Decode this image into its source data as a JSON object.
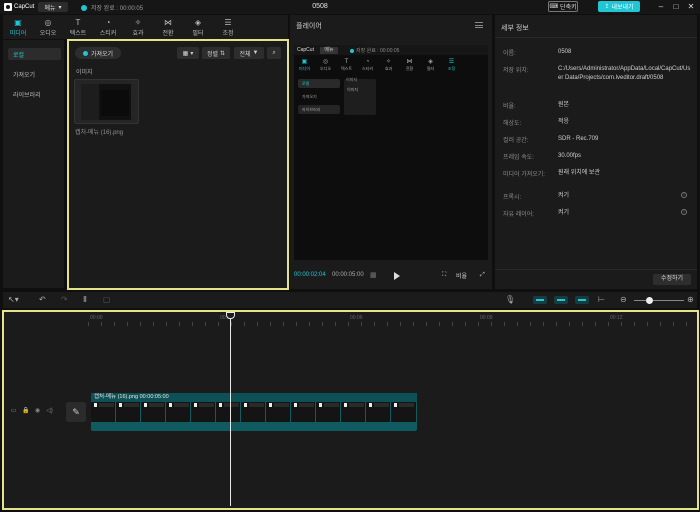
{
  "app": {
    "name": "CapCut",
    "menu_label": "메뉴",
    "autosave_text": "저장 완료 : 00:00:05",
    "project_title": "0508",
    "shortcut_label": "단축키",
    "export_label": "내보내기",
    "colors": {
      "accent": "#1fc7d4",
      "highlight_border": "#e6e28a"
    }
  },
  "toolbar": {
    "tools": [
      {
        "label": "미디어",
        "icon": "media-icon",
        "active": true
      },
      {
        "label": "오디오",
        "icon": "audio-icon"
      },
      {
        "label": "텍스트",
        "icon": "text-icon"
      },
      {
        "label": "스티커",
        "icon": "sticker-icon"
      },
      {
        "label": "효과",
        "icon": "effects-icon"
      },
      {
        "label": "전환",
        "icon": "transition-icon"
      },
      {
        "label": "필터",
        "icon": "filter-icon"
      },
      {
        "label": "조정",
        "icon": "adjust-icon"
      }
    ]
  },
  "leftnav": {
    "items": [
      {
        "label": "로컬",
        "active": true
      },
      {
        "label": "가져오기"
      },
      {
        "label": "라이브러리"
      }
    ]
  },
  "media": {
    "import_label": "가져오기",
    "sort_label": "정렬",
    "filter_label": "전체",
    "section_label": "이미지",
    "items": [
      {
        "name": "캡처-메뉴 (16).png"
      }
    ]
  },
  "player": {
    "title": "플레이어",
    "current_time": "00:00:02:04",
    "total_time": "00:00:05:00",
    "ratio_label": "비율",
    "preview": {
      "logo": "CapCut",
      "menu": "메뉴",
      "autosave": "저장 완료 : 00:00:05",
      "tools": [
        "미디어",
        "오디오",
        "텍스트",
        "스티커",
        "효과",
        "전환",
        "필터",
        "조정"
      ],
      "nav": [
        "로컬",
        "가져오기",
        "라이브러리"
      ],
      "section_label": "이미지",
      "box_text": "이미지"
    }
  },
  "details": {
    "title": "세부 정보",
    "rows": [
      {
        "key": "이름:",
        "value": "0508"
      },
      {
        "key": "저장 위치:",
        "value": "C:/Users/Administrator/AppData/Local/CapCut/User Data/Projects/com.lveditor.draft/0508"
      },
      {
        "key": "비율:",
        "value": "원본"
      },
      {
        "key": "해상도:",
        "value": "적응"
      },
      {
        "key": "컬러 공간:",
        "value": "SDR - Rec.709"
      },
      {
        "key": "프레임 속도:",
        "value": "30.00fps"
      },
      {
        "key": "미디어 가져오기:",
        "value": "원래 위치에 보관"
      },
      {
        "key": "프록시:",
        "value": "켜기",
        "help": true
      },
      {
        "key": "자유 레이어:",
        "value": "켜기",
        "help": true
      }
    ],
    "modify_label": "수정하기"
  },
  "timeline": {
    "ruler": [
      "00:00",
      "00:03",
      "00:06",
      "00:09",
      "00:12"
    ],
    "clip_label": "캡처-메뉴 (16).png  00:00:05:00"
  }
}
